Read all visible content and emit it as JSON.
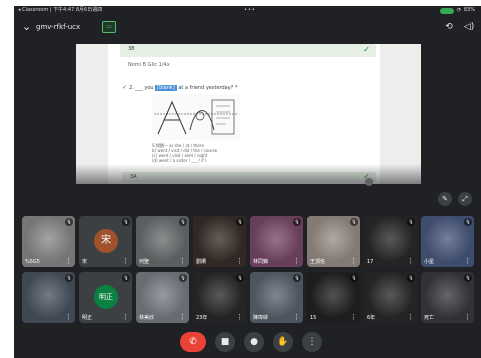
{
  "status_bar": {
    "left_text": "◂ Classroom | 下午4:47 8月6日週四",
    "center_text": "•••",
    "right_text": "83%"
  },
  "top_bar": {
    "back_icon": "chevron-down-icon",
    "meeting_code": "gmv-rfkf-ucx",
    "present_icon": "present-screen-icon",
    "camera_switch_icon": "camera-switch-icon",
    "speaker_icon": "speaker-icon"
  },
  "shared_screen": {
    "q1_label": "3B",
    "q1_note": "Nomi B Glic 1/4x",
    "q2_prefix": "2. ___ you",
    "q2_highlight": "[blank]",
    "q2_suffix": "at a friend yesterday? *",
    "answers": [
      "S:問題一 a) she / at / there",
      "b) went / visit / did / the / course",
      "(c) went / visit / sent / night",
      "(d) went / a sister / ___ / if I"
    ],
    "answer_bar_label": "3A",
    "pin_icon": "pin-icon",
    "layout_icon": "layout-icon"
  },
  "tiles": [
    {
      "name": "%5G5",
      "kind": "photo",
      "color": "#8a8a8a"
    },
    {
      "name": "宋",
      "kind": "avatar",
      "initial": "宋",
      "color": "#a0522d"
    },
    {
      "name": "何聖",
      "kind": "photo",
      "color": "#6b6e70"
    },
    {
      "name": "劉姍",
      "kind": "photo",
      "color": "#3a2e2a"
    },
    {
      "name": "林同錦",
      "kind": "photo",
      "color": "#7a4a6a"
    },
    {
      "name": "王頂信",
      "kind": "photo",
      "color": "#9a8f88"
    },
    {
      "name": "17",
      "kind": "photo",
      "color": "#2a2a2a"
    },
    {
      "name": "小星",
      "kind": "photo",
      "color": "#4a5a80"
    },
    {
      "name": "",
      "kind": "photo",
      "color": "#4b5563"
    },
    {
      "name": "明正",
      "kind": "avatar",
      "initial": "明正",
      "color": "#0b8043"
    },
    {
      "name": "林美欣",
      "kind": "photo",
      "color": "#7a7f86"
    },
    {
      "name": "23年",
      "kind": "photo",
      "color": "#2a2a2a"
    },
    {
      "name": "陳瑋緯",
      "kind": "photo",
      "color": "#5a6470"
    },
    {
      "name": "15",
      "kind": "photo",
      "color": "#222222"
    },
    {
      "name": "6年",
      "kind": "photo",
      "color": "#2a2a2a"
    },
    {
      "name": "死亡",
      "kind": "photo",
      "color": "#3a3b3e"
    }
  ],
  "controls": [
    {
      "name": "end-call-button",
      "icon": "phone-icon",
      "glyph": "✆"
    },
    {
      "name": "camera-toggle-button",
      "icon": "camera-icon",
      "glyph": "■"
    },
    {
      "name": "mic-toggle-button",
      "icon": "mic-icon",
      "glyph": "●"
    },
    {
      "name": "raise-hand-button",
      "icon": "hand-icon",
      "glyph": "✋"
    },
    {
      "name": "more-options-button",
      "icon": "more-icon",
      "glyph": "⋮"
    }
  ]
}
